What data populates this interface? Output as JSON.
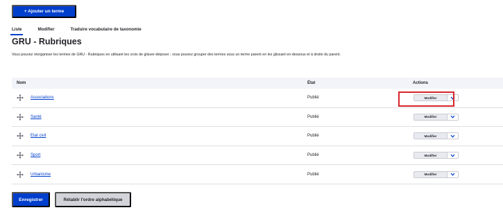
{
  "toolbar": {
    "add_term_label": "+ Ajouter un terme"
  },
  "tabs": [
    {
      "label": "Liste",
      "active": true
    },
    {
      "label": "Modifier",
      "active": false
    },
    {
      "label": "Traduire vocabulaire de taxonomie",
      "active": false
    }
  ],
  "page": {
    "title": "GRU - Rubriques",
    "description": "Vous pouvez réorganiser les termes de GRU - Rubriques en utilisant les croix de glisser-déposer ; vous pouvez grouper des termes sous un terme parent en les glissant en-dessous et à droite du parent."
  },
  "table": {
    "headers": {
      "name": "Nom",
      "state": "État",
      "actions": "Actions"
    },
    "rows": [
      {
        "name": "Associations",
        "state": "Publié",
        "action": "Modifier"
      },
      {
        "name": "Santé",
        "state": "Publié",
        "action": "Modifier"
      },
      {
        "name": "Etat civil",
        "state": "Publié",
        "action": "Modifier"
      },
      {
        "name": "Sport",
        "state": "Publié",
        "action": "Modifier"
      },
      {
        "name": "Urbanisme",
        "state": "Publié",
        "action": "Modifier"
      }
    ]
  },
  "footer": {
    "save_label": "Enregistrer",
    "reset_label": "Rétablir l'ordre alphabétique"
  },
  "colors": {
    "primary": "#003ecc",
    "highlight": "#d6242b"
  },
  "icons": {
    "drag_handle": "drag-handle-icon",
    "dropdown_toggle": "chevron-down-icon"
  }
}
